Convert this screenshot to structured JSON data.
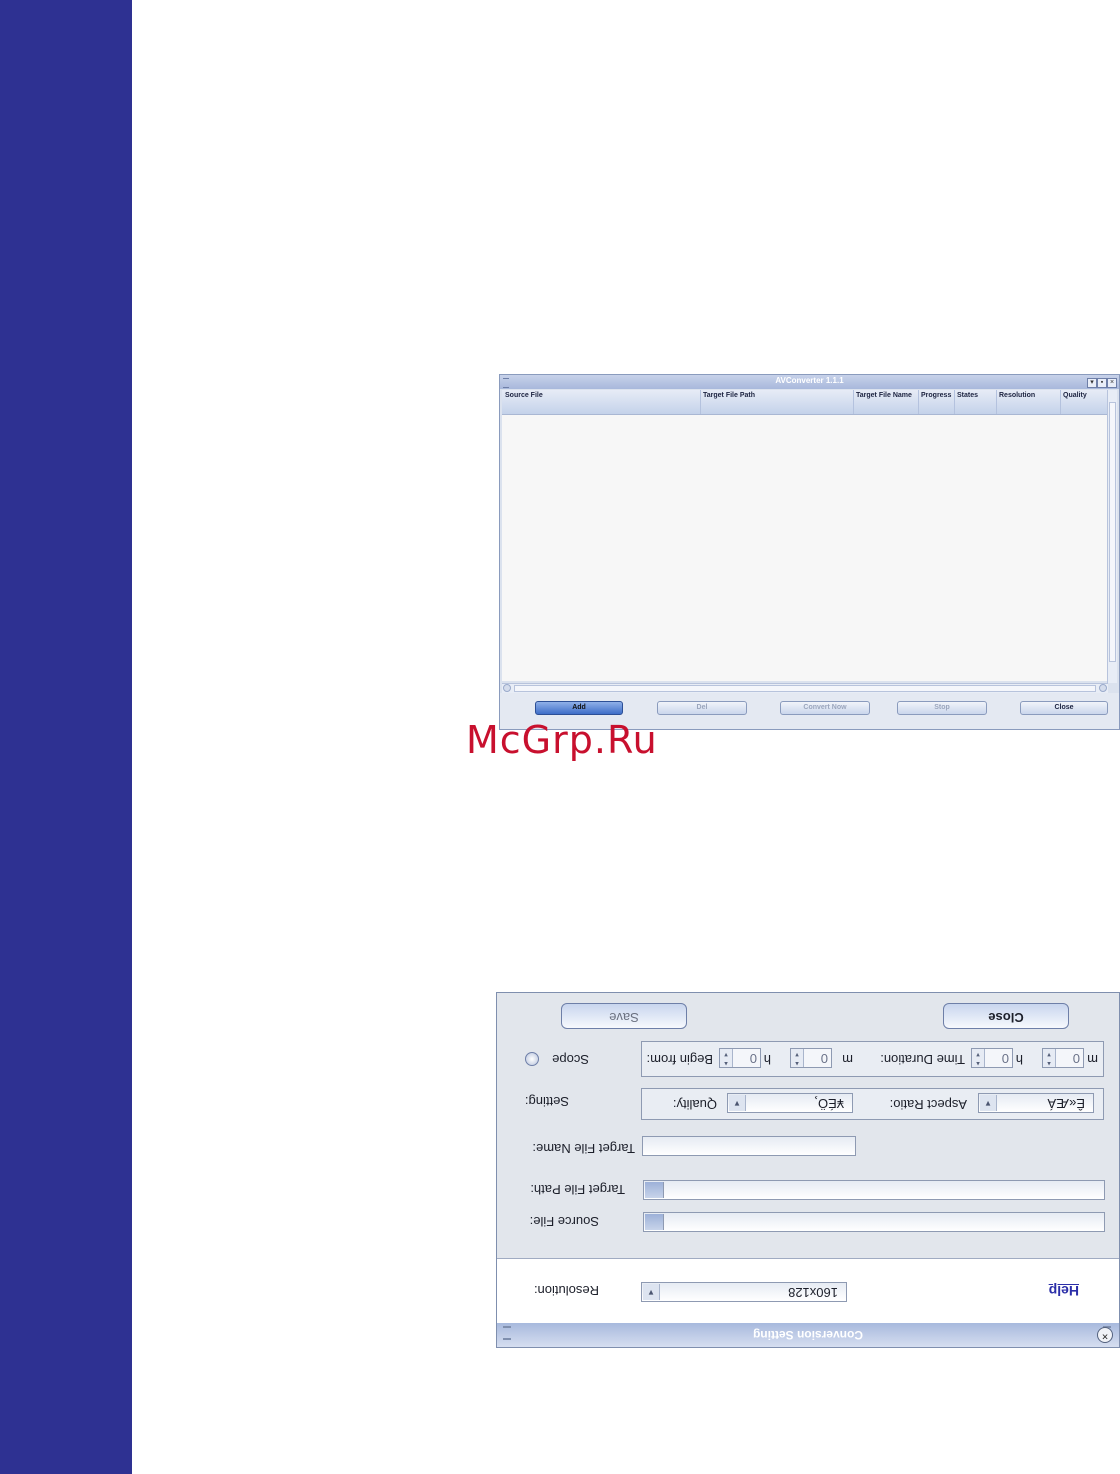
{
  "converter": {
    "title": "AVConverter 1.1.1",
    "columns": [
      "Source File",
      "Target File Path",
      "Target File Name",
      "Progress",
      "States",
      "Resolution",
      "Quality"
    ],
    "buttons": {
      "add": "Add",
      "del": "Del",
      "convert": "Convert Now",
      "stop": "Stop",
      "close": "Close"
    }
  },
  "watermark": "McGrp.Ru",
  "settings": {
    "title": "Conversion Setting",
    "help": "Help",
    "resolution_label": "Resolution:",
    "resolution_value": "160x128",
    "source_file_label": "Source File:",
    "target_path_label": "Target File Path:",
    "target_name_label": "Target File Name:",
    "setting_label": "Setting:",
    "quality_label": "Quality:",
    "quality_value": "¥ÉÖ¸",
    "aspect_label": "Aspect Ratio:",
    "aspect_value": "Ê«ÆÁ",
    "scope_label": "Scope",
    "begin_label": "Begin from:",
    "begin_h": "0",
    "h_unit": "h",
    "begin_m": "0",
    "m_unit": "m",
    "duration_label": "Time Duration:",
    "duration_h": "0",
    "duration_m": "0",
    "save": "Save",
    "close": "Close"
  },
  "colors": {
    "page_sidebar": "#2e3192",
    "watermark": "#c8102e",
    "help_link": "#2b2ea8"
  }
}
